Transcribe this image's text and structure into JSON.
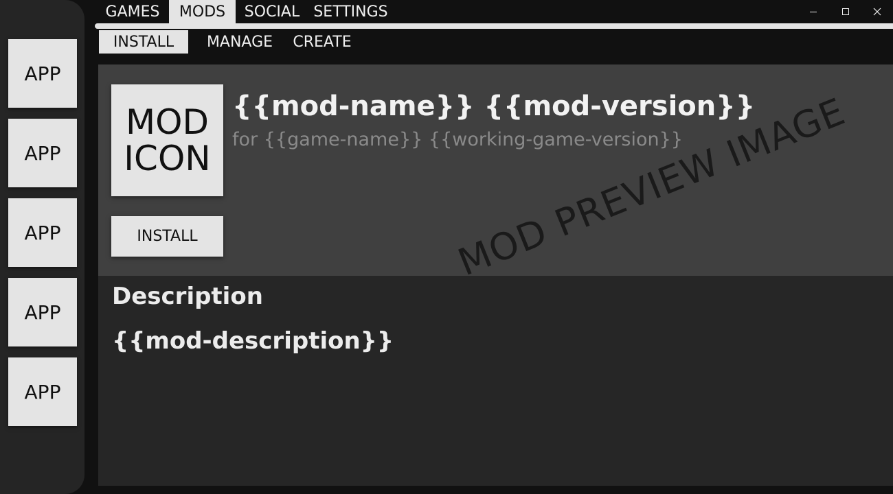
{
  "rail": {
    "apps": [
      {
        "label": "APP"
      },
      {
        "label": "APP"
      },
      {
        "label": "APP"
      },
      {
        "label": "APP"
      },
      {
        "label": "APP"
      }
    ]
  },
  "menu": {
    "tabs": [
      {
        "label": "GAMES"
      },
      {
        "label": "MODS",
        "active": true
      },
      {
        "label": "SOCIAL"
      },
      {
        "label": "SETTINGS"
      }
    ]
  },
  "window_controls": {
    "minimize_icon": "minimize-icon",
    "maximize_icon": "maximize-icon",
    "close_icon": "close-icon"
  },
  "subtabs": [
    {
      "label": "INSTALL",
      "active": true
    },
    {
      "label": "MANAGE"
    },
    {
      "label": "CREATE"
    }
  ],
  "mod": {
    "icon_label_line1": "MOD",
    "icon_label_line2": "ICON",
    "title": "{{mod-name}} {{mod-version}}",
    "subtitle": "for {{game-name}} {{working-game-version}}",
    "preview_watermark": "MOD PREVIEW IMAGE",
    "install_label": "INSTALL"
  },
  "description": {
    "heading": "Description",
    "body": "{{mod-description}}"
  },
  "colors": {
    "background": "#111111",
    "rail": "#252525",
    "panel": "#262626",
    "banner": "#404040",
    "button": "#e4e4e4",
    "text_light": "#f0f0f0",
    "text_muted": "#8a8a8a"
  }
}
